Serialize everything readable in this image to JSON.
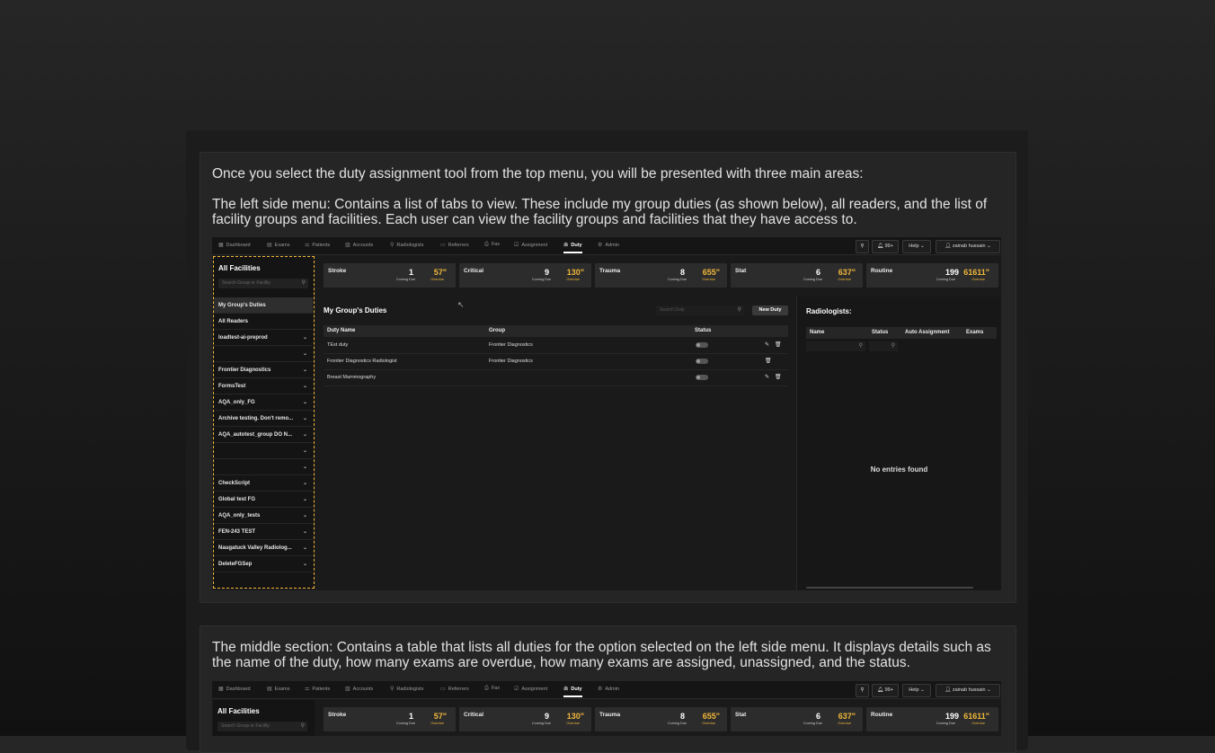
{
  "intro": "Once you select the duty assignment tool from the top menu, you will be presented with three main areas:",
  "left_menu_text": "The left side menu: Contains a list of tabs to view. These include my group duties (as shown below), all readers, and the list of facility groups and facilities.  Each user can view the facility groups and facilities that they have access to.",
  "middle_text": "The middle section: Contains a table that lists all duties for the option selected on the left side menu. It displays details such as the name of the duty, how many exams are overdue, how many exams are assigned, unassigned, and the status.",
  "app": {
    "nav": [
      {
        "label": "Dashboard",
        "icon": "dashboard-icon",
        "glyph": "▦"
      },
      {
        "label": "Exams",
        "icon": "exams-icon",
        "glyph": "▤"
      },
      {
        "label": "Patients",
        "icon": "patients-icon",
        "glyph": "⚌"
      },
      {
        "label": "Accounts",
        "icon": "accounts-icon",
        "glyph": "▥"
      },
      {
        "label": "Radiologists",
        "icon": "radiologists-icon",
        "glyph": "⚲"
      },
      {
        "label": "Referrers",
        "icon": "referrers-icon",
        "glyph": "▭"
      },
      {
        "label": "Fax",
        "icon": "fax-icon",
        "glyph": "⎙"
      },
      {
        "label": "Assignment",
        "icon": "assignment-icon",
        "glyph": "☑"
      },
      {
        "label": "Duty",
        "icon": "duty-icon",
        "glyph": "☗"
      },
      {
        "label": "Admin",
        "icon": "admin-icon",
        "glyph": "⚙"
      }
    ],
    "notifications": "99+",
    "help": "Help",
    "user": "zainab hussain",
    "sidebar": {
      "title": "All Facilities",
      "search_placeholder": "Search Group or Facility",
      "items": [
        "My Group's Duties",
        "All Readers",
        "loadtest-ai-preprod",
        "",
        "Frontier Diagnostics",
        "FormsTest",
        "AQA_only_FG",
        "Archive testing. Don't remo...",
        "AQA_autotest_group DO N...",
        "",
        "",
        "CheckScript",
        "Global test FG",
        "AQA_only_tests",
        "FEN-243 TEST",
        "Naugatuck Valley Radiolog...",
        "DeleteFGSep"
      ]
    },
    "stats": [
      {
        "label": "Stroke",
        "due": "1",
        "due_label": "Coming Due",
        "overdue": "57\"",
        "overdue_label": "Overdue"
      },
      {
        "label": "Critical",
        "due": "9",
        "due_label": "Coming Due",
        "overdue": "130\"",
        "overdue_label": "Overdue"
      },
      {
        "label": "Trauma",
        "due": "8",
        "due_label": "Coming Due",
        "overdue": "655\"",
        "overdue_label": "Overdue"
      },
      {
        "label": "Stat",
        "due": "6",
        "due_label": "Coming Due",
        "overdue": "637\"",
        "overdue_label": "Overdue"
      },
      {
        "label": "Routine",
        "due": "199",
        "due_label": "Coming Due",
        "overdue": "61611\"",
        "overdue_label": "Overdue"
      }
    ],
    "duties": {
      "title": "My Group's Duties",
      "search_placeholder": "Search Duty",
      "new_button": "New Duty",
      "columns": [
        "Duty Name",
        "Group",
        "Status"
      ],
      "rows": [
        {
          "name": "TEst duty",
          "group": "Frontier Diagnostics"
        },
        {
          "name": "Frontier Diagnostics Radiologist",
          "group": "Frontier Diagnostics"
        },
        {
          "name": "Breast Mammography",
          "group": ""
        }
      ]
    },
    "radiologists": {
      "title": "Radiologists:",
      "columns": [
        "Name",
        "Status",
        "Auto Assignment",
        "Exams"
      ],
      "empty": "No entries found"
    }
  }
}
